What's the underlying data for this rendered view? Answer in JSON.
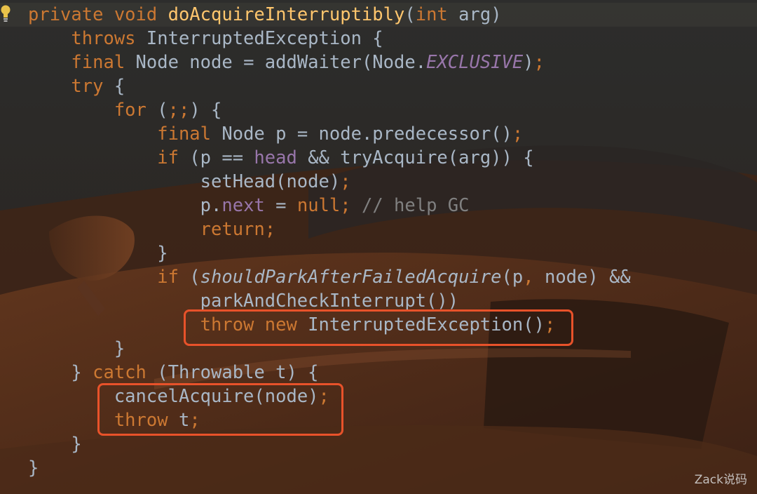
{
  "editor": {
    "lines": [
      {
        "segments": [
          {
            "text": "private ",
            "cls": "kw"
          },
          {
            "text": "void ",
            "cls": "kw"
          },
          {
            "text": "doAcquireInterruptibly",
            "cls": "fn"
          },
          {
            "text": "(",
            "cls": "pl"
          },
          {
            "text": "int ",
            "cls": "kw"
          },
          {
            "text": "arg)",
            "cls": "pl"
          }
        ]
      },
      {
        "segments": [
          {
            "text": "    ",
            "cls": "pl"
          },
          {
            "text": "throws ",
            "cls": "kw"
          },
          {
            "text": "InterruptedException {",
            "cls": "pl"
          }
        ]
      },
      {
        "segments": [
          {
            "text": "    ",
            "cls": "pl"
          },
          {
            "text": "final ",
            "cls": "kw"
          },
          {
            "text": "Node node = addWaiter(Node.",
            "cls": "pl"
          },
          {
            "text": "EXCLUSIVE",
            "cls": "fld it"
          },
          {
            "text": ")",
            "cls": "pl"
          },
          {
            "text": ";",
            "cls": "kw"
          }
        ]
      },
      {
        "segments": [
          {
            "text": "    ",
            "cls": "pl"
          },
          {
            "text": "try ",
            "cls": "kw"
          },
          {
            "text": "{",
            "cls": "pl"
          }
        ]
      },
      {
        "segments": [
          {
            "text": "        ",
            "cls": "pl"
          },
          {
            "text": "for ",
            "cls": "kw"
          },
          {
            "text": "(",
            "cls": "pl"
          },
          {
            "text": ";;",
            "cls": "kw"
          },
          {
            "text": ") {",
            "cls": "pl"
          }
        ]
      },
      {
        "segments": [
          {
            "text": "            ",
            "cls": "pl"
          },
          {
            "text": "final ",
            "cls": "kw"
          },
          {
            "text": "Node p = node.predecessor()",
            "cls": "pl"
          },
          {
            "text": ";",
            "cls": "kw"
          }
        ]
      },
      {
        "segments": [
          {
            "text": "            ",
            "cls": "pl"
          },
          {
            "text": "if ",
            "cls": "kw"
          },
          {
            "text": "(p == ",
            "cls": "pl"
          },
          {
            "text": "head ",
            "cls": "fld"
          },
          {
            "text": "&& tryAcquire(arg)) {",
            "cls": "pl"
          }
        ]
      },
      {
        "segments": [
          {
            "text": "                ",
            "cls": "pl"
          },
          {
            "text": "setHead(node)",
            "cls": "pl"
          },
          {
            "text": ";",
            "cls": "kw"
          }
        ]
      },
      {
        "segments": [
          {
            "text": "                ",
            "cls": "pl"
          },
          {
            "text": "p.",
            "cls": "pl"
          },
          {
            "text": "next ",
            "cls": "fld"
          },
          {
            "text": "= ",
            "cls": "pl"
          },
          {
            "text": "null",
            "cls": "kw"
          },
          {
            "text": "; ",
            "cls": "kw"
          },
          {
            "text": "// help GC",
            "cls": "cm"
          }
        ]
      },
      {
        "segments": [
          {
            "text": "                ",
            "cls": "pl"
          },
          {
            "text": "return;",
            "cls": "kw"
          }
        ]
      },
      {
        "segments": [
          {
            "text": "            }",
            "cls": "pl"
          }
        ]
      },
      {
        "segments": [
          {
            "text": "            ",
            "cls": "pl"
          },
          {
            "text": "if ",
            "cls": "kw"
          },
          {
            "text": "(",
            "cls": "pl"
          },
          {
            "text": "shouldParkAfterFailedAcquire",
            "cls": "pl it"
          },
          {
            "text": "(p",
            "cls": "pl"
          },
          {
            "text": ", ",
            "cls": "kw"
          },
          {
            "text": "node) &&",
            "cls": "pl"
          }
        ]
      },
      {
        "segments": [
          {
            "text": "                ",
            "cls": "pl"
          },
          {
            "text": "parkAndCheckInterrupt())",
            "cls": "pl"
          }
        ]
      },
      {
        "segments": [
          {
            "text": "                ",
            "cls": "pl"
          },
          {
            "text": "throw new ",
            "cls": "kw"
          },
          {
            "text": "InterruptedException()",
            "cls": "pl"
          },
          {
            "text": ";",
            "cls": "kw"
          }
        ]
      },
      {
        "segments": [
          {
            "text": "        }",
            "cls": "pl"
          }
        ]
      },
      {
        "segments": [
          {
            "text": "    } ",
            "cls": "pl"
          },
          {
            "text": "catch ",
            "cls": "kw"
          },
          {
            "text": "(Throwable t) {",
            "cls": "pl"
          }
        ]
      },
      {
        "segments": [
          {
            "text": "        ",
            "cls": "pl"
          },
          {
            "text": "cancelAcquire(node)",
            "cls": "pl"
          },
          {
            "text": ";",
            "cls": "kw"
          }
        ]
      },
      {
        "segments": [
          {
            "text": "        ",
            "cls": "pl"
          },
          {
            "text": "throw ",
            "cls": "kw"
          },
          {
            "text": "t",
            "cls": "pl"
          },
          {
            "text": ";",
            "cls": "kw"
          }
        ]
      },
      {
        "segments": [
          {
            "text": "    }",
            "cls": "pl"
          }
        ]
      },
      {
        "segments": [
          {
            "text": "}",
            "cls": "pl"
          }
        ]
      }
    ]
  },
  "watermark": "Zack说码",
  "colors": {
    "keyword": "#cc7832",
    "method": "#ffc66d",
    "field": "#9876aa",
    "plain": "#a9b7c6",
    "comment": "#808080",
    "highlight_box": "#e8522a"
  },
  "icons": {
    "gutter": "lightbulb-icon"
  }
}
